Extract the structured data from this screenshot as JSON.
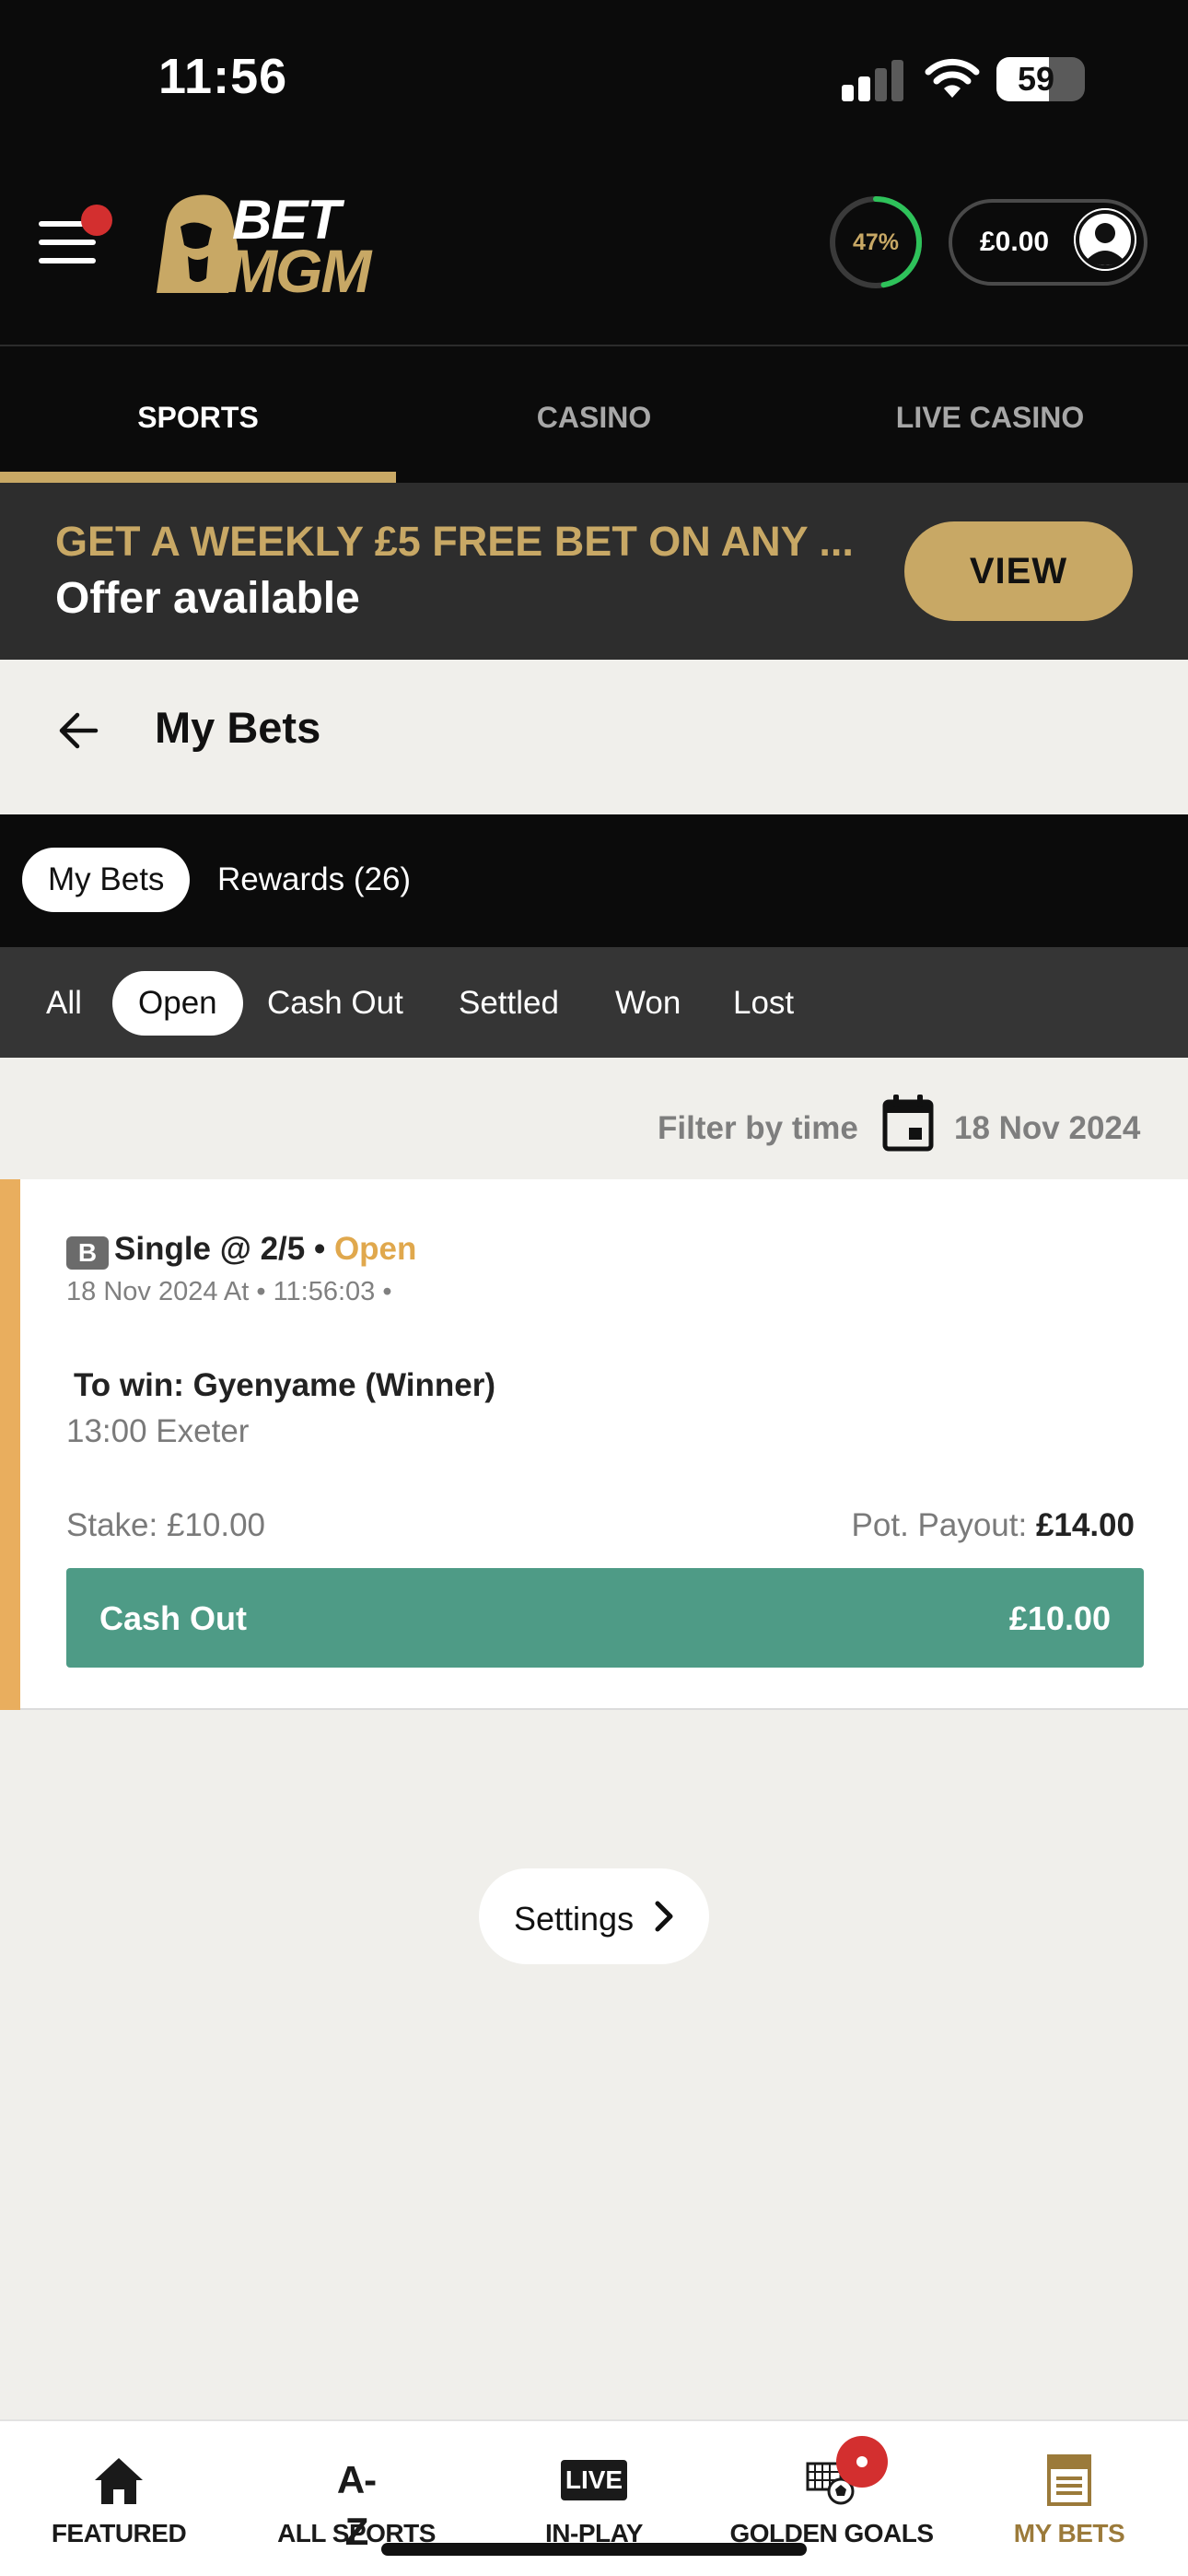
{
  "status": {
    "time": "11:56",
    "battery": "59"
  },
  "header": {
    "brand_top": "BET",
    "brand_bottom": "MGM",
    "progress_label": "47%",
    "progress_value": 0.47,
    "balance": "£0.00"
  },
  "top_nav": [
    {
      "label": "SPORTS",
      "active": true
    },
    {
      "label": "CASINO",
      "active": false
    },
    {
      "label": "LIVE CASINO",
      "active": false
    }
  ],
  "promo": {
    "title": "GET A WEEKLY £5 FREE BET ON ANY ...",
    "subtitle": "Offer available",
    "button": "VIEW"
  },
  "page": {
    "title": "My Bets"
  },
  "main_tabs": [
    {
      "label": "My Bets",
      "active": true
    },
    {
      "label": "Rewards (26)",
      "active": false
    }
  ],
  "filter_tabs": [
    {
      "label": "All",
      "active": false
    },
    {
      "label": "Open",
      "active": true
    },
    {
      "label": "Cash Out",
      "active": false
    },
    {
      "label": "Settled",
      "active": false
    },
    {
      "label": "Won",
      "active": false
    },
    {
      "label": "Lost",
      "active": false
    }
  ],
  "filter": {
    "label": "Filter by time",
    "date": "18 Nov 2024"
  },
  "bet": {
    "badge": "B",
    "type": "Single @ 2/5",
    "separator": " • ",
    "status": "Open",
    "date": "18 Nov 2024 At • 11:56:03 •",
    "selection": "To win: Gyenyame (Winner)",
    "event": "13:00 Exeter",
    "stake": "Stake: £10.00",
    "payout_label": "Pot. Payout: ",
    "payout_value": "£14.00",
    "cashout_label": "Cash Out",
    "cashout_value": "£10.00"
  },
  "settings": {
    "label": "Settings"
  },
  "bottom_nav": [
    {
      "label": "FEATURED",
      "icon": "home-icon",
      "active": false
    },
    {
      "label": "ALL SPORTS",
      "icon": "a-z-icon",
      "active": false
    },
    {
      "label": "IN-PLAY",
      "icon": "live-icon",
      "active": false
    },
    {
      "label": "GOLDEN GOALS",
      "icon": "golden-goals-icon",
      "active": false
    },
    {
      "label": "MY BETS",
      "icon": "receipt-icon",
      "active": true
    }
  ],
  "icons": {
    "az_text": "A-Z",
    "live_text": "LIVE"
  },
  "colors": {
    "gold": "#c8a865",
    "cashout_green": "#4e9b86",
    "open_status": "#e0a84d",
    "progress_green": "#2ec25a"
  }
}
